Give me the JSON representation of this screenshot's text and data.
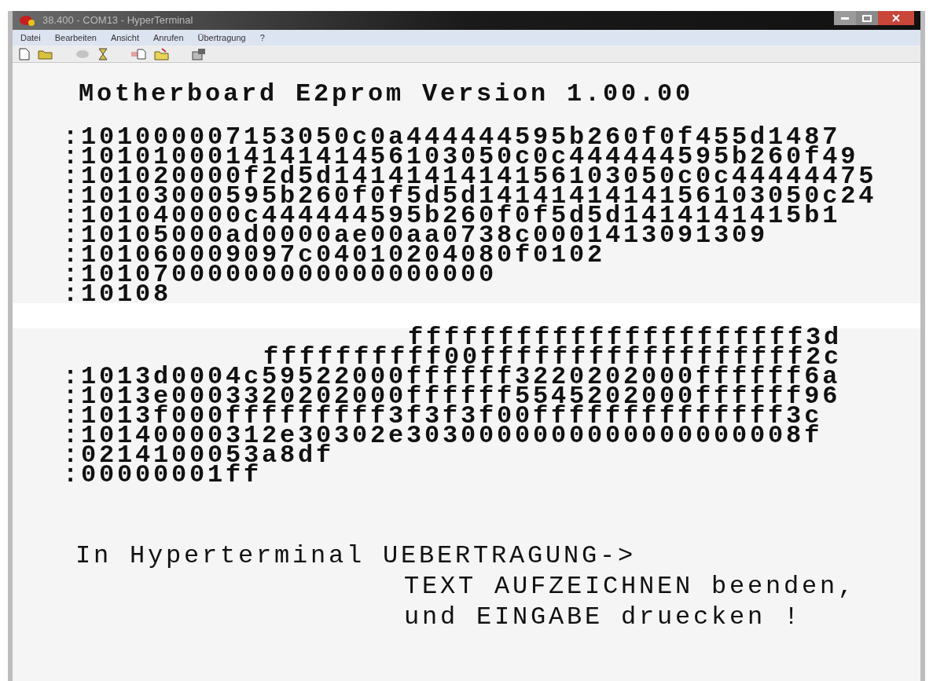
{
  "window": {
    "title": "38.400 - COM13 - HyperTerminal"
  },
  "menu": [
    "Datei",
    "Bearbeiten",
    "Ansicht",
    "Anrufen",
    "Übertragung",
    "?"
  ],
  "terminal": {
    "heading": "Motherboard E2prom Version 1.00.00",
    "lines_above_tear": [
      ":101000007153050c0a444444595b260f0f455d1487",
      ":101010001414141456103050c0c444444595b260f49",
      ":101020000f2d5d1414141414156103050c0c44444475",
      ":10103000595b260f0f5d5d1414141414156103050c24",
      ":101040000c444444595b260f0f5d5d1414141415b1",
      ":10105000ad0000ae00aa0738c0001413091309",
      ":101060009097c04010204080f0102",
      ":10107000000000000000000",
      ":10108"
    ],
    "lines_below_tear": [
      {
        "kind": "torn",
        "text": "ffffffffffffffffffffff3d"
      },
      {
        "kind": "torn",
        "text": "ffffffffff00ffffffffffffffffff2c"
      },
      {
        "kind": "full",
        "text": ":1013d0004c59522000ffffff3220202000ffffff6a"
      },
      {
        "kind": "full",
        "text": ":1013e0003320202000ffffff5545202000ffffff96"
      },
      {
        "kind": "full",
        "text": ":1013f000fffffffff3f3f3f00ffffffffffffff3c"
      },
      {
        "kind": "full",
        "text": ":10140000312e30302e3030000000000000000008f"
      },
      {
        "kind": "full",
        "text": ":0214100053a8df"
      },
      {
        "kind": "full",
        "text": ":00000001ff"
      }
    ],
    "footer": [
      {
        "kind": "left",
        "text": "In Hyperterminal UEBERTRAGUNG->"
      },
      {
        "kind": "indented",
        "text": "TEXT AUFZEICHNEN beenden,"
      },
      {
        "kind": "indented",
        "text": "und EINGABE druecken !"
      }
    ]
  }
}
